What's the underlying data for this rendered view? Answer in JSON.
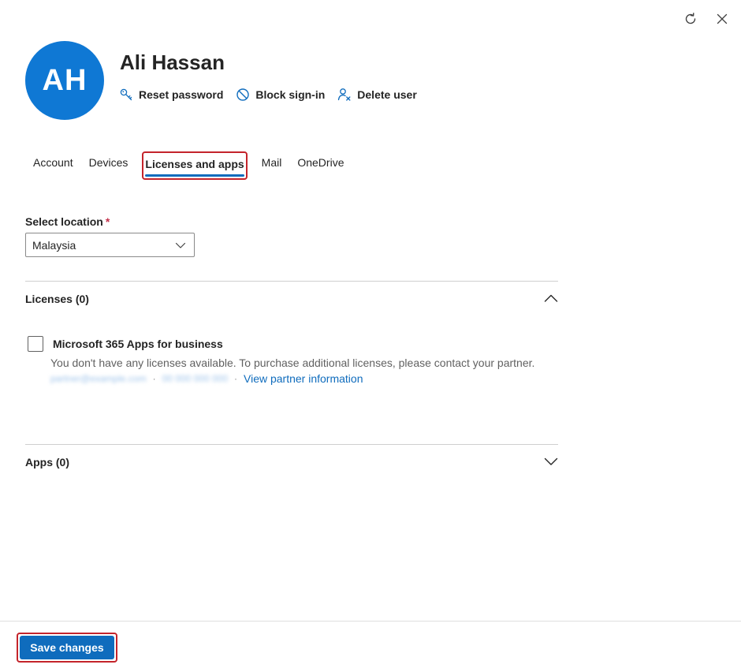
{
  "user": {
    "initials": "AH",
    "name": "Ali Hassan",
    "avatar_color": "#0f78d4"
  },
  "actions": [
    {
      "label": "Reset password",
      "icon": "key-icon"
    },
    {
      "label": "Block sign-in",
      "icon": "block-icon"
    },
    {
      "label": "Delete user",
      "icon": "delete-user-icon"
    }
  ],
  "tabs": [
    {
      "label": "Account"
    },
    {
      "label": "Devices"
    },
    {
      "label": "Licenses and apps",
      "active": true
    },
    {
      "label": "Mail"
    },
    {
      "label": "OneDrive"
    }
  ],
  "location": {
    "label": "Select location",
    "required_marker": "*",
    "value": "Malaysia"
  },
  "licenses": {
    "title": "Licenses (0)",
    "expanded": true,
    "items": [
      {
        "name": "Microsoft 365 Apps for business",
        "checked": false,
        "description": "You don't have any licenses available. To purchase additional licenses, please contact your partner.",
        "partner_email": "partner@example.com",
        "partner_phone": "00 000 000 000",
        "separator": "·",
        "link_label": "View partner information"
      }
    ]
  },
  "apps": {
    "title": "Apps (0)",
    "expanded": false
  },
  "footer": {
    "save_label": "Save changes"
  },
  "colors": {
    "accent": "#0f6cbd",
    "highlight_border": "#c4242b",
    "required": "#c4314b"
  }
}
